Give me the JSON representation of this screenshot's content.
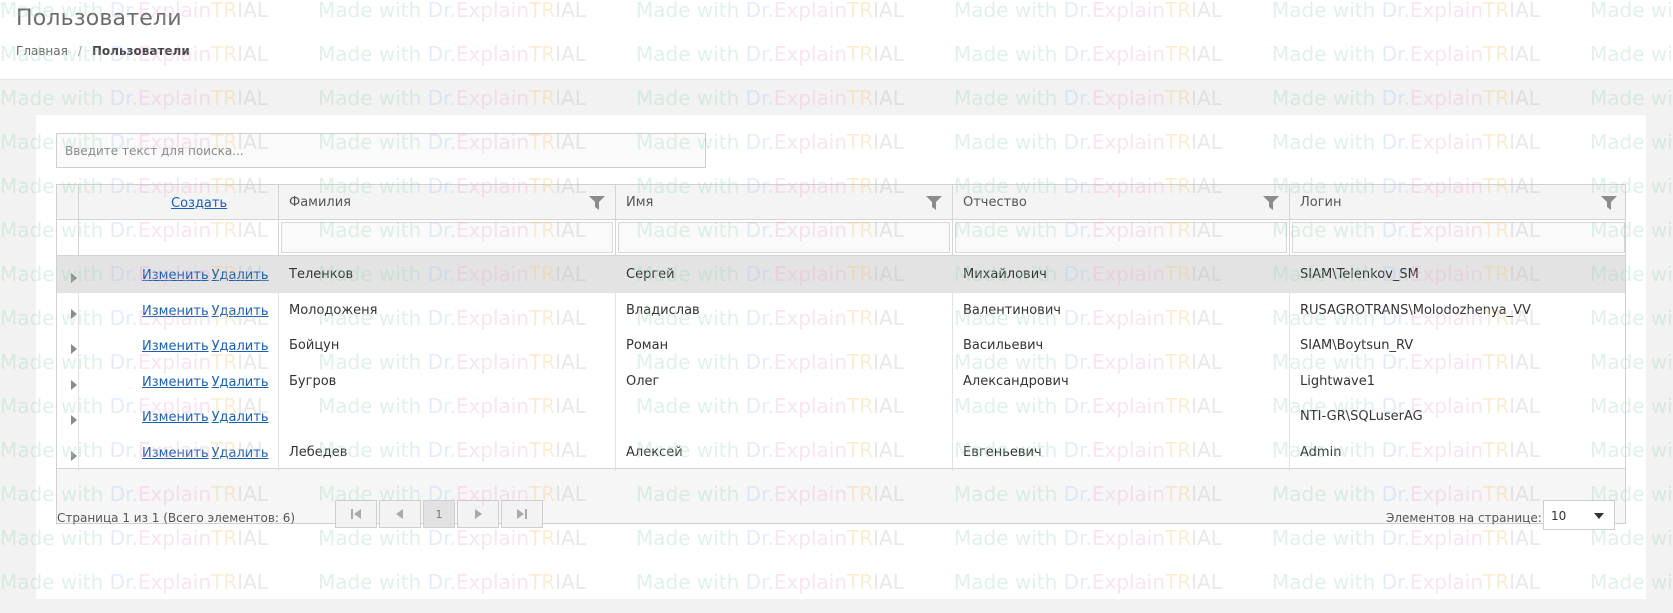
{
  "page": {
    "title": "Пользователи",
    "breadcrumb": {
      "home": "Главная",
      "separator": "/",
      "current": "Пользователи"
    }
  },
  "search": {
    "placeholder": "Введите текст для поиска...",
    "value": ""
  },
  "grid": {
    "create_label": "Создать",
    "columns": [
      "Фамилия",
      "Имя",
      "Отчество",
      "Логин"
    ],
    "edit_label": "Изменить",
    "delete_label": "Удалить",
    "selected_row": 0,
    "rows": [
      {
        "last": "Теленков",
        "first": "Сергей",
        "middle": "Михайлович",
        "login": "SIAM\\Telenkov_SM"
      },
      {
        "last": "Молодоженя",
        "first": "Владислав",
        "middle": "Валентинович",
        "login": "RUSAGROTRANS\\Molodozhenya_VV"
      },
      {
        "last": "Бойцун",
        "first": "Роман",
        "middle": "Васильевич",
        "login": "SIAM\\Boytsun_RV"
      },
      {
        "last": "Бугров",
        "first": "Олег",
        "middle": "Александрович",
        "login": "Lightwave1"
      },
      {
        "last": "",
        "first": "",
        "middle": "",
        "login": "NTI-GR\\SQLuserAG"
      },
      {
        "last": "Лебедев",
        "first": "Алексей",
        "middle": "Евгеньевич",
        "login": "Admin"
      }
    ]
  },
  "pager": {
    "info": "Страница 1 из 1 (Всего элементов: 6)",
    "current_page": "1",
    "page_size_label": "Элементов на странице:",
    "page_size": "10"
  },
  "watermark": {
    "made_with": "Made with ",
    "dr": "Dr.",
    "explain": "Explain",
    "tr": "TR",
    "ial": "IAL"
  },
  "colors": {
    "link": "#1a5fb4",
    "selected_row": "#e3e3e3",
    "header_bg": "#f4f4f4"
  },
  "icons": [
    "filter-icon",
    "expand-arrow-icon",
    "first-page-icon",
    "prev-page-icon",
    "next-page-icon",
    "last-page-icon",
    "dropdown-arrow-icon"
  ]
}
